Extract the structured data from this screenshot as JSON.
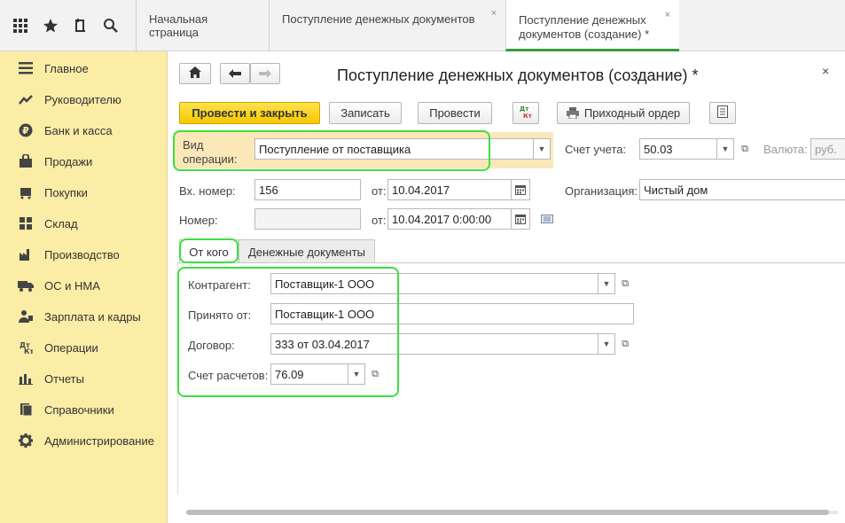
{
  "top_icons": [
    "apps-grid-icon",
    "star-icon",
    "history-icon",
    "search-icon"
  ],
  "tabs": [
    {
      "label": "Начальная страница"
    },
    {
      "label": "Поступление денежных документов",
      "close": "×"
    },
    {
      "label_line1": "Поступление денежных",
      "label_line2": "документов (создание) *",
      "close": "×"
    }
  ],
  "sidebar": {
    "items": [
      {
        "label": "Главное",
        "icon": "menu-icon"
      },
      {
        "label": "Руководителю",
        "icon": "trend-icon"
      },
      {
        "label": "Банк и касса",
        "icon": "ruble-icon"
      },
      {
        "label": "Продажи",
        "icon": "bag-icon"
      },
      {
        "label": "Покупки",
        "icon": "cart-icon"
      },
      {
        "label": "Склад",
        "icon": "warehouse-icon"
      },
      {
        "label": "Производство",
        "icon": "factory-icon"
      },
      {
        "label": "ОС и НМА",
        "icon": "truck-icon"
      },
      {
        "label": "Зарплата и кадры",
        "icon": "people-icon"
      },
      {
        "label": "Операции",
        "icon": "dt-kt-icon"
      },
      {
        "label": "Отчеты",
        "icon": "bar-chart-icon"
      },
      {
        "label": "Справочники",
        "icon": "books-icon"
      },
      {
        "label": "Администрирование",
        "icon": "gear-icon"
      }
    ]
  },
  "form": {
    "title": "Поступление денежных документов (создание) *",
    "close": "×",
    "toolbar": {
      "post_close": "Провести и закрыть",
      "save": "Записать",
      "post": "Провести",
      "dt_kt": "Дт Кт",
      "order": "Приходный ордер"
    },
    "op_type": {
      "label1": "Вид",
      "label2": "операции:",
      "value": "Поступление от поставщика"
    },
    "account": {
      "label": "Счет учета:",
      "value": "50.03"
    },
    "currency": {
      "label": "Валюта:",
      "value": "руб."
    },
    "in_number": {
      "label": "Вх. номер:",
      "value": "156",
      "date_label": "от:",
      "date": "10.04.2017"
    },
    "organization": {
      "label": "Организация:",
      "value": "Чистый дом"
    },
    "number": {
      "label": "Номер:",
      "value": "",
      "date_label": "от:",
      "date": "10.04.2017  0:00:00"
    },
    "subtabs": [
      "От кого",
      "Денежные документы"
    ],
    "counterparty": {
      "label": "Контрагент:",
      "value": "Поставщик-1 ООО"
    },
    "received_from": {
      "label": "Принято от:",
      "value": "Поставщик-1 ООО"
    },
    "contract": {
      "label": "Договор:",
      "value": "333 от 03.04.2017"
    },
    "settlement": {
      "label": "Счет расчетов:",
      "value": "76.09"
    }
  },
  "colors": {
    "sidebar_bg": "#fbeca6",
    "primary_button": "#f5c800",
    "highlight": "#3de03d",
    "active_tab_underline": "#3a9b3a"
  }
}
